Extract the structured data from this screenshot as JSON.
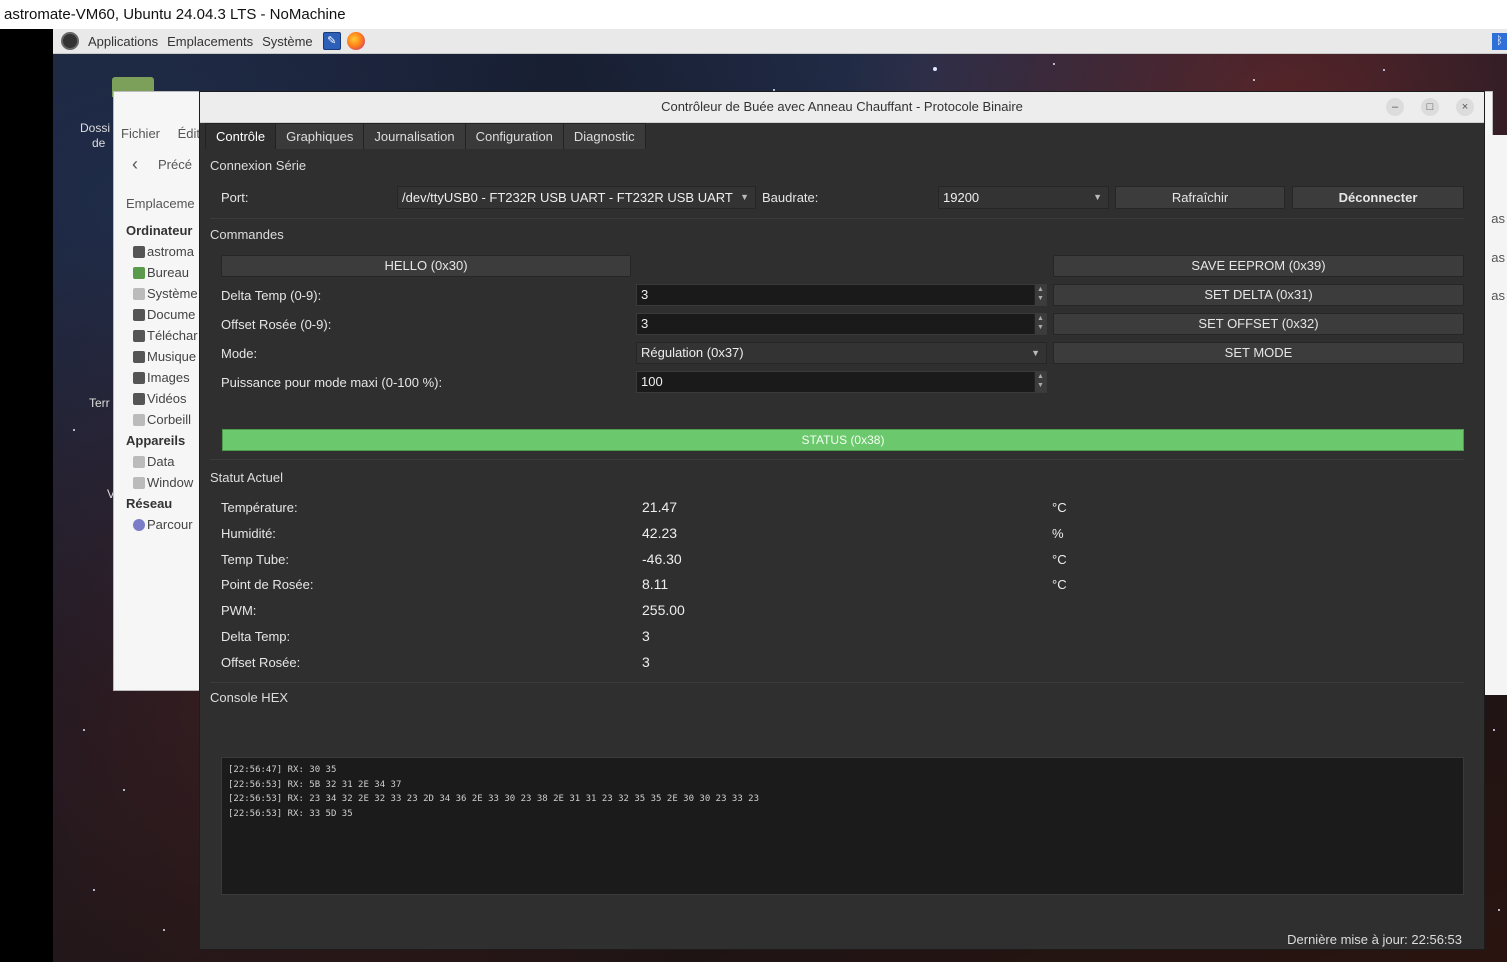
{
  "nx_window": {
    "title": "astromate-VM60, Ubuntu 24.04.3 LTS - NoMachine"
  },
  "top_panel": {
    "applications": "Applications",
    "places": "Emplacements",
    "system": "Système"
  },
  "desktop": {
    "icon_dossier_1": "Dossi",
    "icon_dossier_2": "de",
    "icon_term": "Terr",
    "icon_v": "V"
  },
  "file_manager": {
    "menu": [
      "Fichier",
      "Édit"
    ],
    "back_label": "Précé",
    "places_label": "Emplaceme",
    "sidebar": [
      {
        "type": "header",
        "label": "Ordinateur"
      },
      {
        "type": "item",
        "label": "astroma",
        "icon": "folder-icon"
      },
      {
        "type": "item",
        "label": "Bureau",
        "icon": "desktop-icon"
      },
      {
        "type": "item",
        "label": "Système",
        "icon": "drive-icon"
      },
      {
        "type": "item",
        "label": "Docume",
        "icon": "folder-icon"
      },
      {
        "type": "item",
        "label": "Téléchar",
        "icon": "folder-icon"
      },
      {
        "type": "item",
        "label": "Musique",
        "icon": "folder-icon"
      },
      {
        "type": "item",
        "label": "Images",
        "icon": "folder-icon"
      },
      {
        "type": "item",
        "label": "Vidéos",
        "icon": "folder-icon"
      },
      {
        "type": "item",
        "label": "Corbeill",
        "icon": "trash-icon"
      },
      {
        "type": "header",
        "label": "Appareils"
      },
      {
        "type": "item",
        "label": "Data",
        "icon": "drive-icon"
      },
      {
        "type": "item",
        "label": "Window",
        "icon": "drive-icon"
      },
      {
        "type": "header",
        "label": "Réseau"
      },
      {
        "type": "item",
        "label": "Parcour",
        "icon": "network-icon"
      }
    ],
    "right_fragments": [
      "as",
      "as",
      "as"
    ]
  },
  "app": {
    "title": "Contrôleur de Buée avec Anneau Chauffant - Protocole Binaire",
    "window_buttons": {
      "minimize": "–",
      "maximize": "□",
      "close": "×"
    },
    "tabs": [
      {
        "label": "Contrôle",
        "active": true
      },
      {
        "label": "Graphiques",
        "active": false
      },
      {
        "label": "Journalisation",
        "active": false
      },
      {
        "label": "Configuration",
        "active": false
      },
      {
        "label": "Diagnostic",
        "active": false
      }
    ],
    "serial": {
      "section": "Connexion Série",
      "port_label": "Port:",
      "port_value": "/dev/ttyUSB0 - FT232R USB UART - FT232R USB UART",
      "baud_label": "Baudrate:",
      "baud_value": "19200",
      "refresh": "Rafraîchir",
      "disconnect": "Déconnecter"
    },
    "commands": {
      "section": "Commandes",
      "hello": "HELLO (0x30)",
      "save_eeprom": "SAVE EEPROM (0x39)",
      "delta_label": "Delta Temp (0-9):",
      "delta_value": "3",
      "set_delta": "SET DELTA (0x31)",
      "offset_label": "Offset Rosée (0-9):",
      "offset_value": "3",
      "set_offset": "SET OFFSET (0x32)",
      "mode_label": "Mode:",
      "mode_value": "Régulation (0x37)",
      "set_mode": "SET MODE",
      "power_label": "Puissance pour mode maxi (0-100 %):",
      "power_value": "100",
      "status_button": "STATUS (0x38)"
    },
    "status": {
      "section": "Statut Actuel",
      "rows": [
        {
          "label": "Température:",
          "value": "21.47",
          "unit": "°C"
        },
        {
          "label": "Humidité:",
          "value": "42.23",
          "unit": "%"
        },
        {
          "label": "Temp Tube:",
          "value": "-46.30",
          "unit": "°C"
        },
        {
          "label": "Point de Rosée:",
          "value": "8.11",
          "unit": "°C"
        },
        {
          "label": "PWM:",
          "value": "255.00",
          "unit": ""
        },
        {
          "label": "Delta Temp:",
          "value": "3",
          "unit": ""
        },
        {
          "label": "Offset Rosée:",
          "value": "3",
          "unit": ""
        }
      ]
    },
    "console": {
      "section": "Console HEX",
      "lines": [
        "[22:56:47] RX: 30 35",
        "[22:56:53] RX: 5B 32 31 2E 34 37",
        "[22:56:53] RX: 23 34 32 2E 32 33 23 2D 34 36 2E 33 30 23 38 2E 31 31 23 32 35 35 2E 30 30 23 33 23",
        "[22:56:53] RX: 33 5D 35"
      ]
    },
    "statusbar": "Dernière mise à jour: 22:56:53"
  },
  "colors": {
    "status_green": "#6cc86c",
    "app_background": "#2f2f2f",
    "console_background": "#1b1b1b"
  }
}
